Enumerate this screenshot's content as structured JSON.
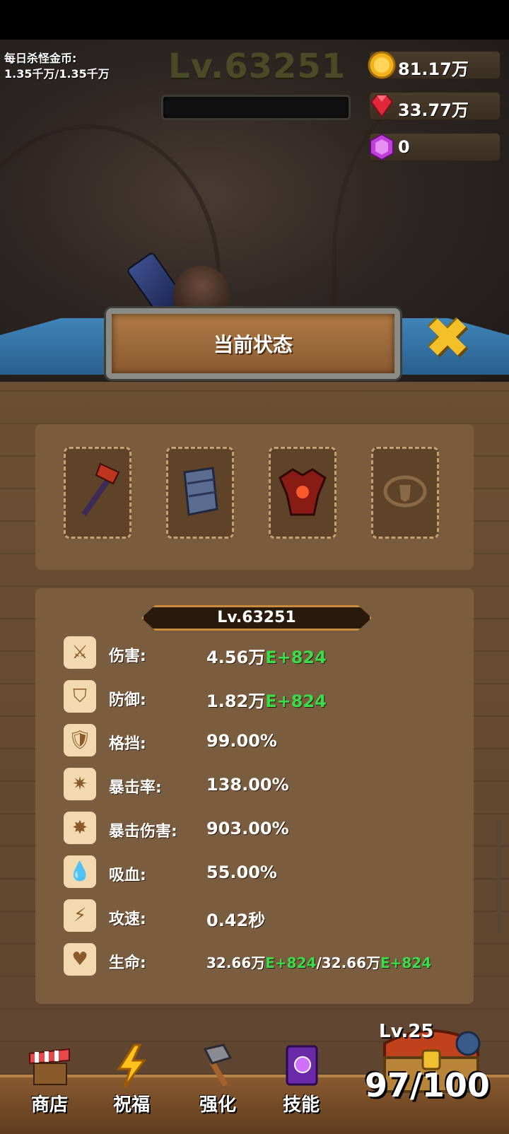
{
  "hud": {
    "daily_label": "每日杀怪金币:",
    "daily_value": "1.35千万/1.35千万",
    "level": "Lv.63251",
    "gold": "81.17万",
    "ruby": "33.77万",
    "gem": "0"
  },
  "panel": {
    "title": "当前状态",
    "level": "Lv.63251"
  },
  "stats": {
    "damage": {
      "label": "伤害:",
      "value": "4.56万",
      "bonus": "E+824"
    },
    "defense": {
      "label": "防御:",
      "value": "1.82万",
      "bonus": "E+824"
    },
    "block": {
      "label": "格挡:",
      "value": "99.00%"
    },
    "crit_rate": {
      "label": "暴击率:",
      "value": "138.00%"
    },
    "crit_damage": {
      "label": "暴击伤害:",
      "value": "903.00%"
    },
    "lifesteal": {
      "label": "吸血:",
      "value": "55.00%"
    },
    "attack_speed": {
      "label": "攻速:",
      "value": "0.42秒"
    },
    "hp": {
      "label": "生命:",
      "value_a": "32.66万",
      "bonus_a": "E+824",
      "sep": "/",
      "value_b": "32.66万",
      "bonus_b": "E+824"
    }
  },
  "nav": {
    "shop": "商店",
    "blessing": "祝福",
    "enhance": "强化",
    "skills": "技能"
  },
  "chest": {
    "level": "Lv.25",
    "count": "97/100"
  },
  "colors": {
    "bonus_green": "#3bdb4a",
    "gold_accent": "#f4c02a",
    "ribbon_blue": "#3f84b8"
  }
}
